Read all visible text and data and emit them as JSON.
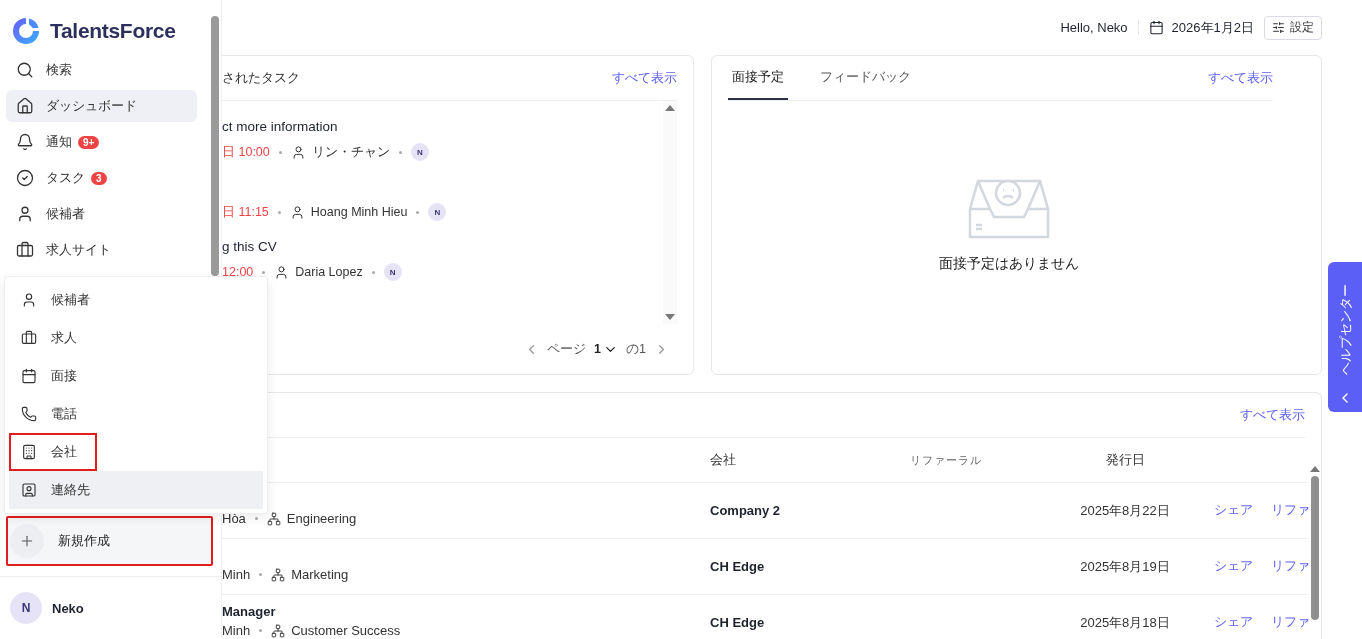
{
  "brand": "TalentsForce",
  "sidebar": {
    "items": [
      {
        "label": "検索",
        "selected": false
      },
      {
        "label": "ダッシュボード",
        "selected": true
      },
      {
        "label": "通知",
        "badge": "9+",
        "selected": false
      },
      {
        "label": "タスク",
        "badge": "3",
        "selected": false
      },
      {
        "label": "候補者",
        "selected": false
      },
      {
        "label": "求人サイト",
        "selected": false
      }
    ],
    "create_button": {
      "label": "新規作成",
      "highlighted": true
    },
    "user": {
      "initial": "N",
      "name": "Neko"
    }
  },
  "create_menu": {
    "items": [
      {
        "label": "候補者",
        "highlighted": false,
        "hovered": false
      },
      {
        "label": "求人",
        "highlighted": false,
        "hovered": false
      },
      {
        "label": "面接",
        "highlighted": false,
        "hovered": false
      },
      {
        "label": "電話",
        "highlighted": false,
        "hovered": false
      },
      {
        "label": "会社",
        "highlighted": true,
        "hovered": false
      },
      {
        "label": "連絡先",
        "highlighted": false,
        "hovered": true
      }
    ]
  },
  "header": {
    "greeting": "Hello, Neko",
    "date": "2026年1月2日",
    "settings": "設定"
  },
  "tasks_card": {
    "title": "されたタスク",
    "view_all": "すべて表示",
    "tasks": [
      {
        "title": "ct more information",
        "time": "日 10:00",
        "assignee": "リン・チャン",
        "avatar": "N"
      },
      {
        "time": "日 11:15",
        "assignee": "Hoang Minh Hieu",
        "avatar": "N"
      },
      {
        "title": "g this CV",
        "time": "12:00",
        "assignee": "Daria Lopez",
        "avatar": "N"
      }
    ],
    "pagination": {
      "page_label": "ページ",
      "page": "1",
      "of": "の1"
    }
  },
  "interview_card": {
    "tabs": [
      {
        "label": "面接予定",
        "selected": true
      },
      {
        "label": "フィードバック",
        "selected": false
      }
    ],
    "view_all": "すべて表示",
    "empty_message": "面接予定はありません"
  },
  "jobs_card": {
    "view_all": "すべて表示",
    "columns": [
      "会社",
      "リファーラル",
      "発行日"
    ],
    "rows": [
      {
        "location": "Hòa",
        "department": "Engineering",
        "company": "Company 2",
        "date": "2025年8月22日",
        "share": "シェア",
        "referral": "リファ"
      },
      {
        "location": "Minh",
        "department": "Marketing",
        "company": "CH Edge",
        "date": "2025年8月19日",
        "share": "シェア",
        "referral": "リファ"
      },
      {
        "title": "Manager",
        "location": "Minh",
        "department": "Customer Success",
        "company": "CH Edge",
        "date": "2025年8月18日",
        "share": "シェア",
        "referral": "リファ"
      }
    ]
  },
  "help_tab": {
    "label": "ヘルプセンター"
  }
}
